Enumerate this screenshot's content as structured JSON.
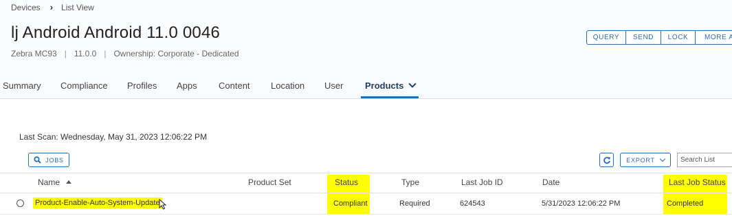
{
  "breadcrumb": {
    "items": [
      "Devices",
      "List View"
    ],
    "separator_icon": "chevron-right-icon"
  },
  "device": {
    "title": "lj Android Android 11.0 0046",
    "model": "Zebra MC93",
    "os_version": "11.0.0",
    "ownership": "Ownership: Corporate - Dedicated"
  },
  "actions": {
    "query": "QUERY",
    "send": "SEND",
    "lock": "LOCK",
    "more": "MORE AC"
  },
  "tabs": [
    {
      "label": "Summary"
    },
    {
      "label": "Compliance"
    },
    {
      "label": "Profiles"
    },
    {
      "label": "Apps"
    },
    {
      "label": "Content"
    },
    {
      "label": "Location"
    },
    {
      "label": "User"
    },
    {
      "label": "Products",
      "active": true
    }
  ],
  "last_scan": "Last Scan: Wednesday, May 31, 2023 12:06:22 PM",
  "toolbar": {
    "jobs_label": "JOBS",
    "export_label": "EXPORT",
    "search_placeholder": "Search List"
  },
  "table": {
    "columns": [
      "Name",
      "Product Set",
      "Status",
      "Type",
      "Last Job ID",
      "Date",
      "Last Job Status"
    ],
    "sort_column": "Name",
    "sort_direction": "ascending",
    "rows": [
      {
        "name": "Product-Enable-Auto-System-Update",
        "product_set": "",
        "status": "Compliant",
        "type": "Required",
        "last_job_id": "624543",
        "date": "5/31/2023 12:06:22 PM",
        "last_job_status": "Completed"
      }
    ]
  },
  "colors": {
    "accent": "#2b6bb3",
    "active_tab_underline": "#1f6fb8",
    "highlight": "#ffff00"
  }
}
